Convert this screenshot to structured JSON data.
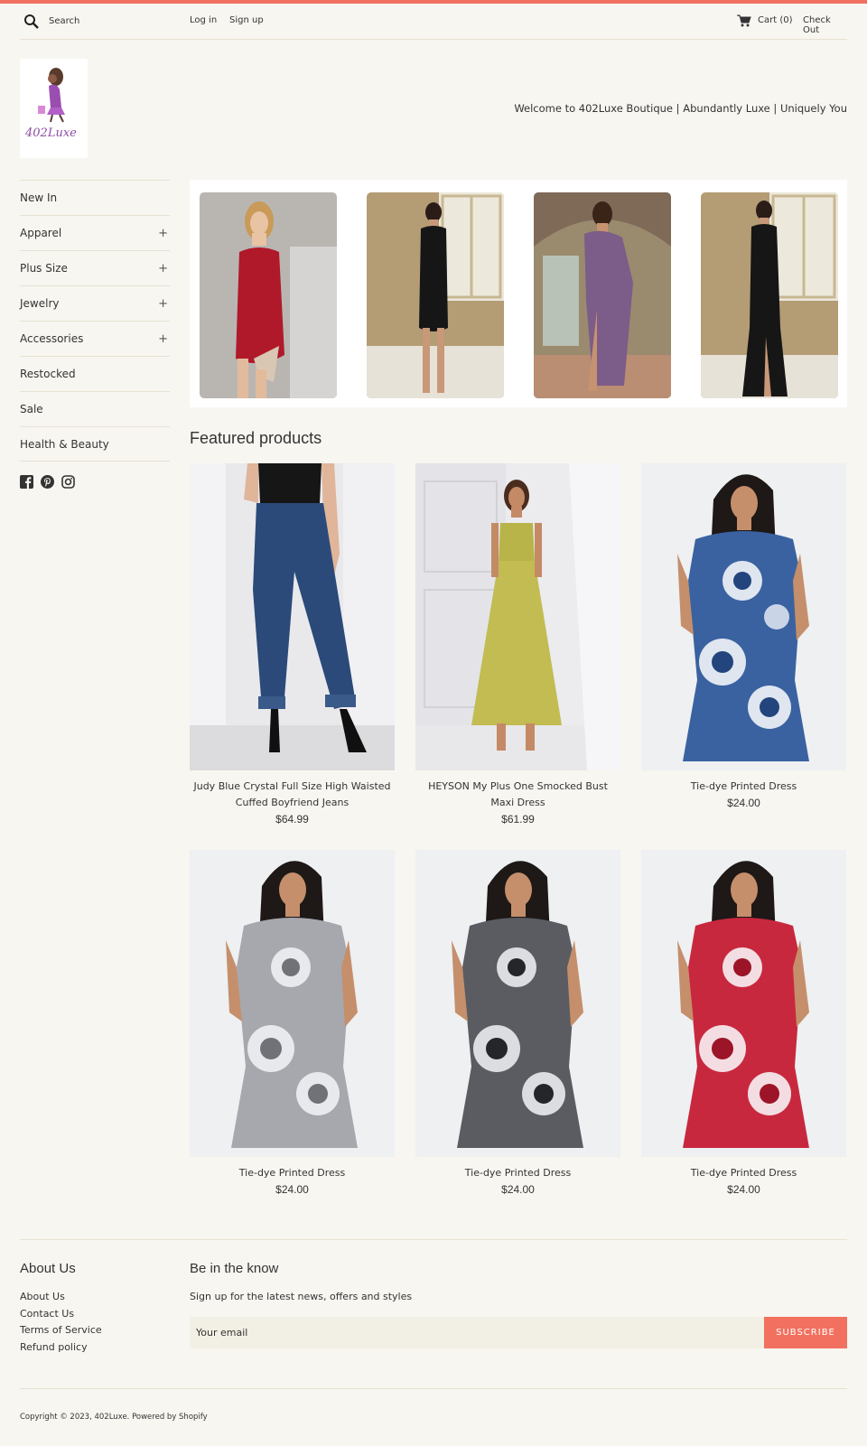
{
  "colors": {
    "accent": "#f2705f",
    "background": "#f8f6f1",
    "rule": "#e7e1d2"
  },
  "header": {
    "search_placeholder": "Search",
    "login": "Log in",
    "signup": "Sign up",
    "cart": "Cart (0)",
    "checkout": "Check Out"
  },
  "logo": {
    "text": "402Luxe"
  },
  "welcome": "Welcome to 402Luxe Boutique | Abundantly Luxe | Uniquely You",
  "sidebar": {
    "items": [
      {
        "label": "New In",
        "expandable": false
      },
      {
        "label": "Apparel",
        "expandable": true
      },
      {
        "label": "Plus Size",
        "expandable": true
      },
      {
        "label": "Jewelry",
        "expandable": true
      },
      {
        "label": "Accessories",
        "expandable": true
      },
      {
        "label": "Restocked",
        "expandable": false
      },
      {
        "label": "Sale",
        "expandable": false
      },
      {
        "label": "Health & Beauty",
        "expandable": false
      }
    ],
    "plus": "+",
    "social": [
      "facebook-icon",
      "pinterest-icon",
      "instagram-icon"
    ]
  },
  "featured": {
    "title": "Featured products",
    "products": [
      {
        "title": "Judy Blue Crystal Full Size High Waisted Cuffed Boyfriend Jeans",
        "price": "$64.99"
      },
      {
        "title": "HEYSON My Plus One Smocked Bust Maxi Dress",
        "price": "$61.99"
      },
      {
        "title": "Tie-dye Printed Dress",
        "price": "$24.00"
      },
      {
        "title": "Tie-dye Printed Dress",
        "price": "$24.00"
      },
      {
        "title": "Tie-dye Printed Dress",
        "price": "$24.00"
      },
      {
        "title": "Tie-dye Printed Dress",
        "price": "$24.00"
      }
    ]
  },
  "footer": {
    "about_heading": "About Us",
    "links": [
      "About Us",
      "Contact Us",
      "Terms of Service",
      "Refund policy"
    ],
    "newsletter_heading": "Be in the know",
    "newsletter_text": "Sign up for the latest news, offers and styles",
    "email_placeholder": "Your email",
    "subscribe": "SUBSCRIBE",
    "copyright": "Copyright © 2023, 402Luxe. Powered by Shopify"
  }
}
